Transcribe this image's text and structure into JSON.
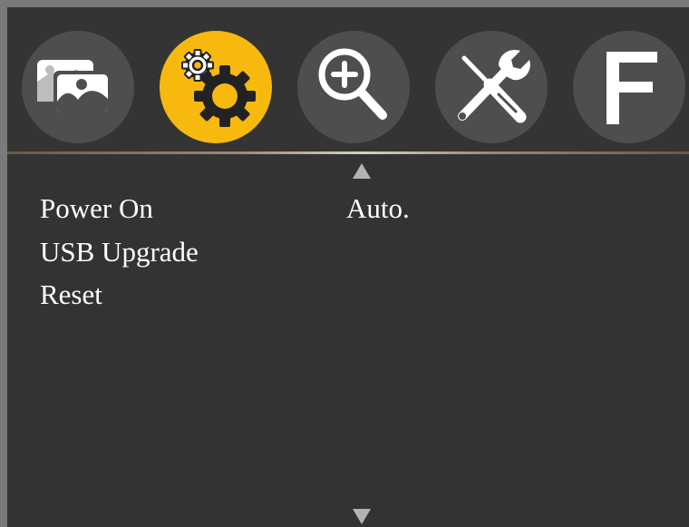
{
  "menu": {
    "tabs": [
      {
        "id": "picture",
        "icon": "picture-icon",
        "active": false
      },
      {
        "id": "setup",
        "icon": "gears-icon",
        "active": true
      },
      {
        "id": "zoom",
        "icon": "zoom-in-icon",
        "active": false
      },
      {
        "id": "tools",
        "icon": "wrench-screwdriver-icon",
        "active": false
      },
      {
        "id": "function",
        "icon": "letter-f-icon",
        "label": "F",
        "active": false
      }
    ],
    "items": [
      {
        "label": "Power On",
        "value": "Auto."
      },
      {
        "label": "USB Upgrade",
        "value": ""
      },
      {
        "label": "Reset",
        "value": ""
      }
    ],
    "scroll_up_icon": "triangle-up-icon",
    "scroll_down_icon": "triangle-down-icon"
  },
  "colors": {
    "background": "#333333",
    "tab_inactive": "#4e4e4e",
    "tab_active": "#f7b90e",
    "icon": "#ffffff",
    "text": "#ffffff",
    "arrow": "#b3b3b3"
  }
}
